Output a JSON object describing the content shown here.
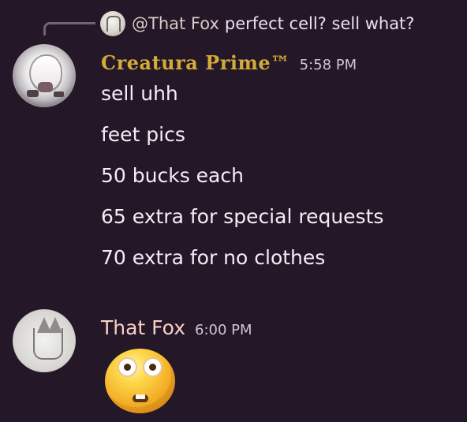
{
  "reply": {
    "author": "@That Fox",
    "text": "perfect cell? sell what?"
  },
  "messages": [
    {
      "author": "Creatura Prime™",
      "timestamp": "5:58 PM",
      "lines": [
        "sell uhh",
        "feet pics",
        "50 bucks each",
        "65 extra for special requests",
        "70 extra for no clothes"
      ],
      "avatar_icon": "anime-avatar-icon",
      "name_color": "#d2ac36"
    },
    {
      "author": "That Fox",
      "timestamp": "6:00 PM",
      "emoji": "flushed-face-emoji",
      "avatar_icon": "fox-sketch-avatar-icon",
      "name_color": "#f6d0c6"
    }
  ]
}
